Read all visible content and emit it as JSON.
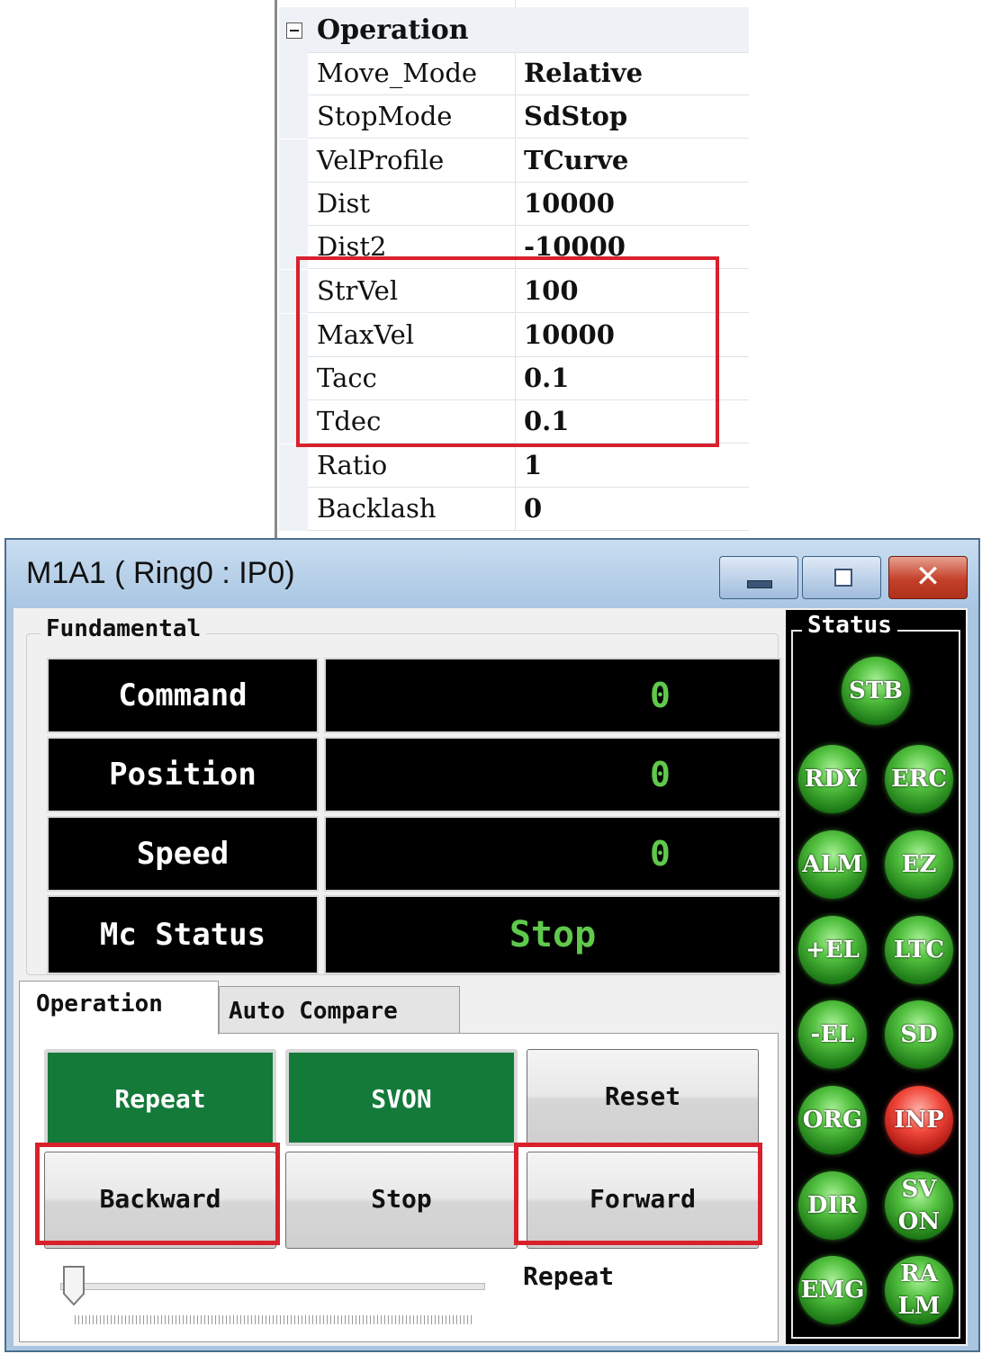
{
  "property_grid": {
    "category": "Operation",
    "rows": [
      {
        "name": "Move_Mode",
        "value": "Relative"
      },
      {
        "name": "StopMode",
        "value": "SdStop"
      },
      {
        "name": "VelProfile",
        "value": "TCurve"
      },
      {
        "name": "Dist",
        "value": "10000"
      },
      {
        "name": "Dist2",
        "value": "-10000"
      },
      {
        "name": "StrVel",
        "value": "100"
      },
      {
        "name": "MaxVel",
        "value": "10000"
      },
      {
        "name": "Tacc",
        "value": "0.1"
      },
      {
        "name": "Tdec",
        "value": "0.1"
      },
      {
        "name": "Ratio",
        "value": "1"
      },
      {
        "name": "Backlash",
        "value": "0"
      }
    ]
  },
  "window": {
    "title": "M1A1 ( Ring0 : IP0)",
    "close_glyph": "✕"
  },
  "fundamental": {
    "legend": "Fundamental",
    "rows": [
      {
        "label": "Command",
        "value": "0"
      },
      {
        "label": "Position",
        "value": "0"
      },
      {
        "label": "Speed",
        "value": "0"
      },
      {
        "label": "Mc Status",
        "value": "Stop"
      }
    ]
  },
  "status": {
    "legend": "Status",
    "leds": [
      {
        "label": "STB",
        "state": "green"
      },
      {
        "label": "RDY",
        "state": "green"
      },
      {
        "label": "ERC",
        "state": "green"
      },
      {
        "label": "ALM",
        "state": "green"
      },
      {
        "label": "EZ",
        "state": "green"
      },
      {
        "label": "+EL",
        "state": "green"
      },
      {
        "label": "LTC",
        "state": "green"
      },
      {
        "label": "-EL",
        "state": "green"
      },
      {
        "label": "SD",
        "state": "green"
      },
      {
        "label": "ORG",
        "state": "green"
      },
      {
        "label": "INP",
        "state": "red"
      },
      {
        "label": "DIR",
        "state": "green"
      },
      {
        "label": "SVON",
        "state": "green"
      },
      {
        "label": "EMG",
        "state": "green"
      },
      {
        "label": "RALM",
        "state": "green"
      }
    ]
  },
  "tabs": [
    {
      "label": "Operation",
      "active": true
    },
    {
      "label": "Auto Compare",
      "active": false
    }
  ],
  "operation": {
    "buttons": {
      "repeat": "Repeat",
      "svon": "SVON",
      "reset": "Reset",
      "backward": "Backward",
      "stop": "Stop",
      "forward": "Forward"
    },
    "slider_label": "Repeat",
    "slider_value": 0
  },
  "colors": {
    "highlight": "#d8212c",
    "active_button": "#147a3a",
    "display_text": "#5fc94b"
  }
}
